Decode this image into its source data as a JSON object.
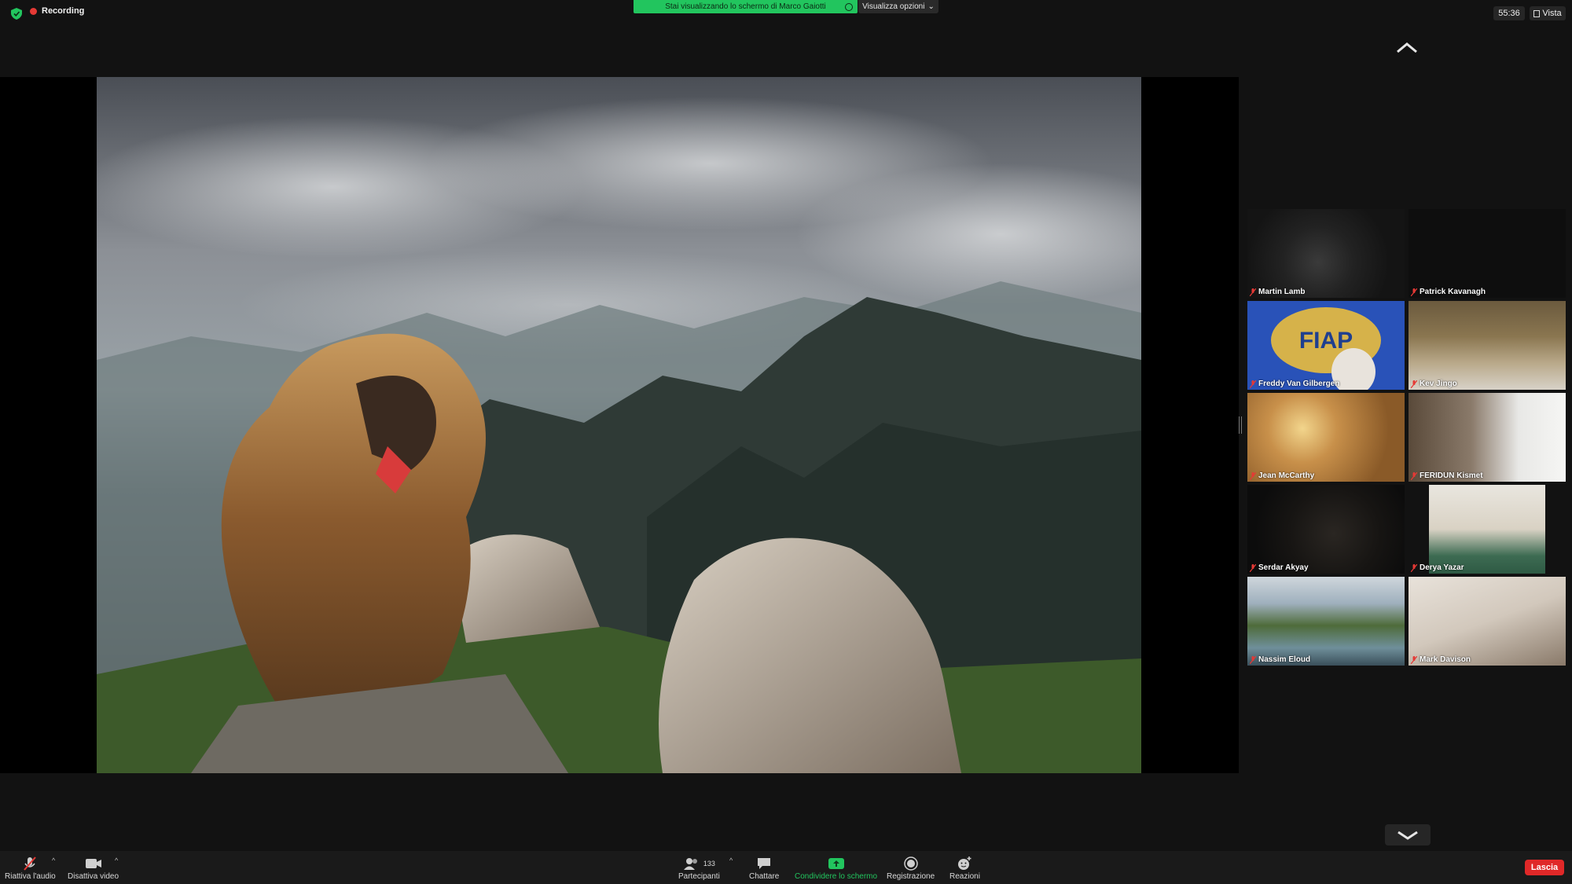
{
  "topbar": {
    "recording_label": "Recording",
    "share_banner": "Stai visualizzando lo schermo di Marco Gaiotti",
    "view_options": "Visualizza opzioni",
    "timer": "55:36",
    "view_label": "Vista"
  },
  "participants": [
    {
      "name": "Martin Lamb"
    },
    {
      "name": "Patrick Kavanagh"
    },
    {
      "name": "Freddy Van Gilbergen"
    },
    {
      "name": "Kev Jingo"
    },
    {
      "name": "Jean McCarthy"
    },
    {
      "name": "FERIDUN Kismet"
    },
    {
      "name": "Serdar Akyay"
    },
    {
      "name": "Derya Yazar"
    },
    {
      "name": "Nassim Eloud"
    },
    {
      "name": "Mark Davison"
    }
  ],
  "logo_text": "FIAP",
  "toolbar": {
    "audio_label": "Riattiva l'audio",
    "video_label": "Disattiva video",
    "participants_label": "Partecipanti",
    "participants_count": "133",
    "chat_label": "Chattare",
    "share_label": "Condividere lo schermo",
    "record_label": "Registrazione",
    "reactions_label": "Reazioni",
    "leave_label": "Lascia"
  },
  "colors": {
    "share_green": "#22c55e",
    "recording_red": "#e53935",
    "leave_red": "#e02828"
  }
}
